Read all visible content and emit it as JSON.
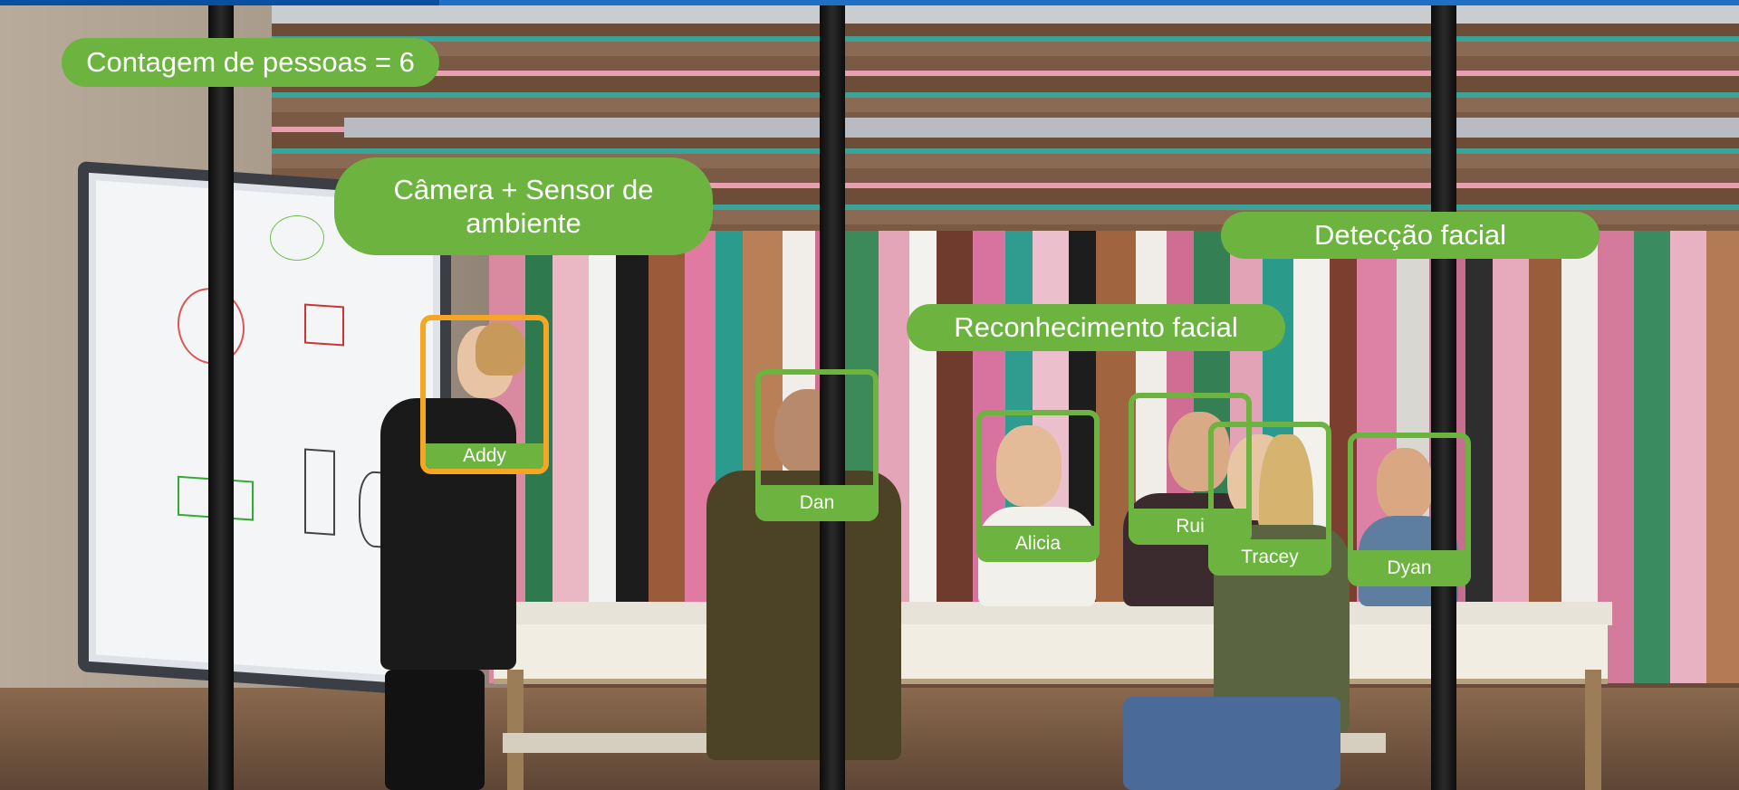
{
  "overlay": {
    "people_count": "Contagem de pessoas = 6",
    "camera_sensor": "Câmera + Sensor de ambiente",
    "face_detection": "Detecção facial",
    "face_recognition": "Reconhecimento facial"
  },
  "faces": [
    {
      "name": "Addy",
      "highlight": "orange"
    },
    {
      "name": "Dan",
      "highlight": "green"
    },
    {
      "name": "Alicia",
      "highlight": "green"
    },
    {
      "name": "Rui",
      "highlight": "green"
    },
    {
      "name": "Tracey",
      "highlight": "green"
    },
    {
      "name": "Dyan",
      "highlight": "green"
    }
  ],
  "colors": {
    "overlay_green": "#6cb43f",
    "recognized_orange": "#f5a623",
    "top_bar_blue": "#1f6fc5"
  }
}
